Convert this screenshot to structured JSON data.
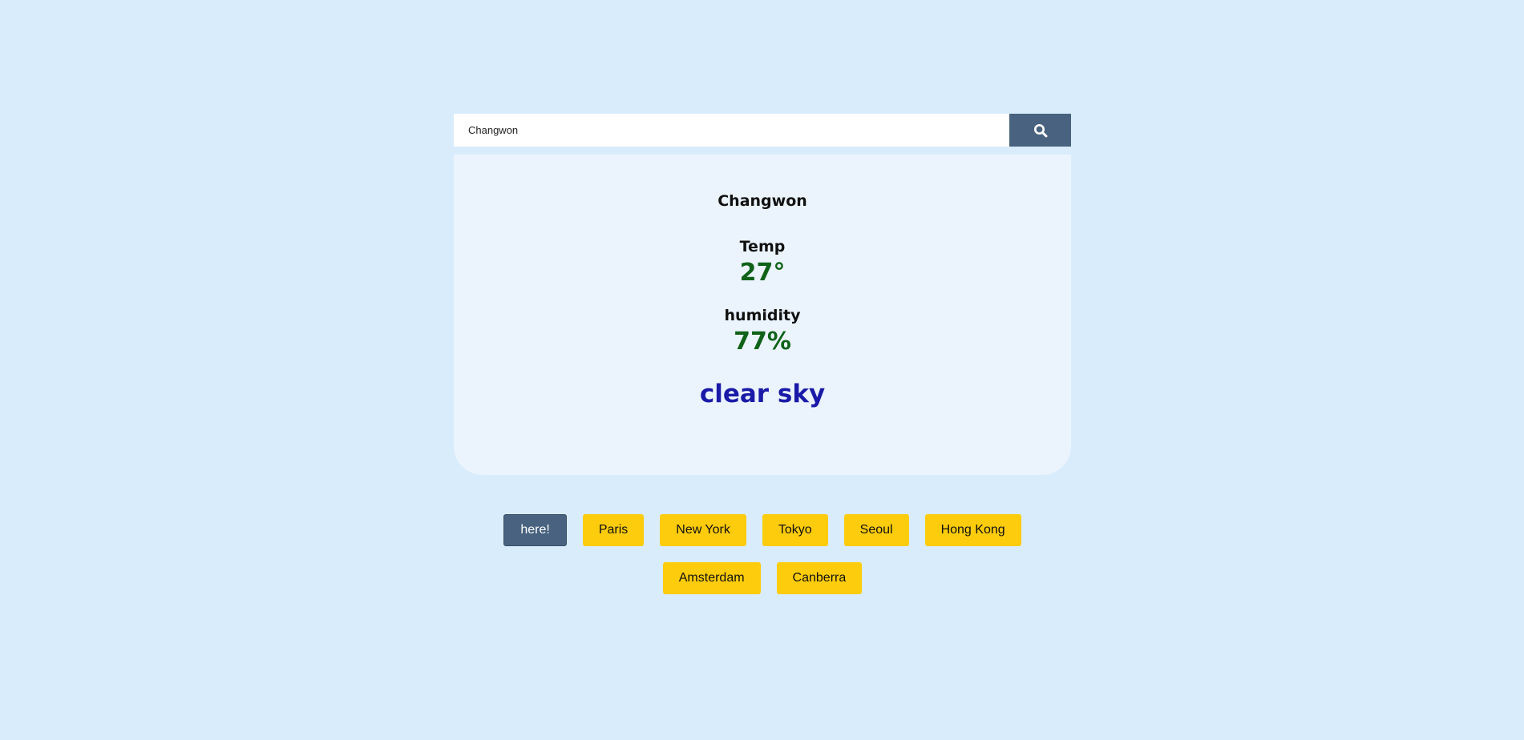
{
  "search": {
    "value": "Changwon",
    "button_icon": "search-icon"
  },
  "weather": {
    "city": "Changwon",
    "temp_label": "Temp",
    "temp_value": "27°",
    "humidity_label": "humidity",
    "humidity_value": "77%",
    "description": "clear sky"
  },
  "city_buttons": [
    {
      "label": "here!"
    },
    {
      "label": "Paris"
    },
    {
      "label": "New York"
    },
    {
      "label": "Tokyo"
    },
    {
      "label": "Seoul"
    },
    {
      "label": "Hong Kong"
    },
    {
      "label": "Amsterdam"
    },
    {
      "label": "Canberra"
    }
  ],
  "colors": {
    "background": "#d9ecfc",
    "card": "#ebf4fd",
    "search_button": "#48627f",
    "city_button": "#fdcc0d",
    "value_green": "#0f6218",
    "description_blue": "#1a1aa8"
  }
}
